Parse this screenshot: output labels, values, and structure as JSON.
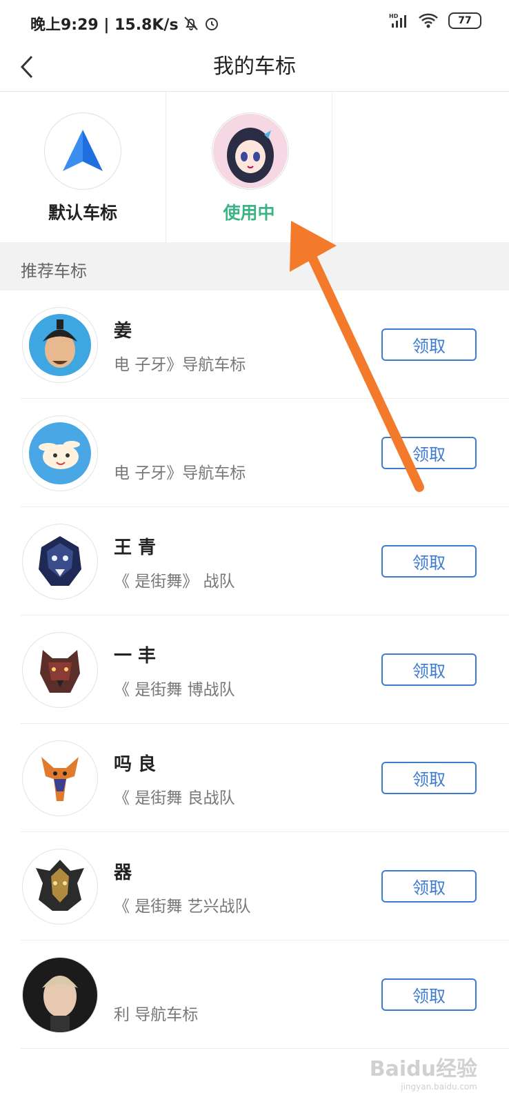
{
  "status_bar": {
    "time": "晚上9:29 | 15.8K/s",
    "battery": "77",
    "icons": [
      "mute-bell-icon",
      "alarm-icon",
      "hd-signal-icon",
      "wifi-icon",
      "battery-icon"
    ]
  },
  "header": {
    "title": "我的车标"
  },
  "current_markers": [
    {
      "label": "默认车标",
      "icon": "navigation-arrow-icon"
    },
    {
      "label": "使用中",
      "icon": "anime-girl-avatar"
    }
  ],
  "section": {
    "title": "推荐车标"
  },
  "markers": [
    {
      "title": "姜",
      "subtitle": "电 子牙》导航车标",
      "button": "领取",
      "avatar": "ancient-man-avatar"
    },
    {
      "title": "",
      "subtitle": "电 子牙》导航车标",
      "button": "领取",
      "avatar": "rabbit-avatar"
    },
    {
      "title": "王 青",
      "subtitle": "《 是街舞》 战队",
      "button": "领取",
      "avatar": "wolf-mask-avatar"
    },
    {
      "title": "一 丰",
      "subtitle": "《 是街舞 博战队",
      "button": "领取",
      "avatar": "panther-avatar"
    },
    {
      "title": "吗 良",
      "subtitle": "《 是街舞 良战队",
      "button": "领取",
      "avatar": "giraffe-avatar"
    },
    {
      "title": "器",
      "subtitle": "《 是街舞 艺兴战队",
      "button": "领取",
      "avatar": "dragon-mask-avatar"
    },
    {
      "title": "",
      "subtitle": "利 导航车标",
      "button": "领取",
      "avatar": "person-photo-avatar"
    }
  ],
  "watermark": {
    "text": "Baidu经验",
    "sub": "jingyan.baidu.com"
  },
  "colors": {
    "accent_blue": "#3d7bd1",
    "active_green": "#3bb384",
    "arrow_orange": "#f47a2b"
  }
}
